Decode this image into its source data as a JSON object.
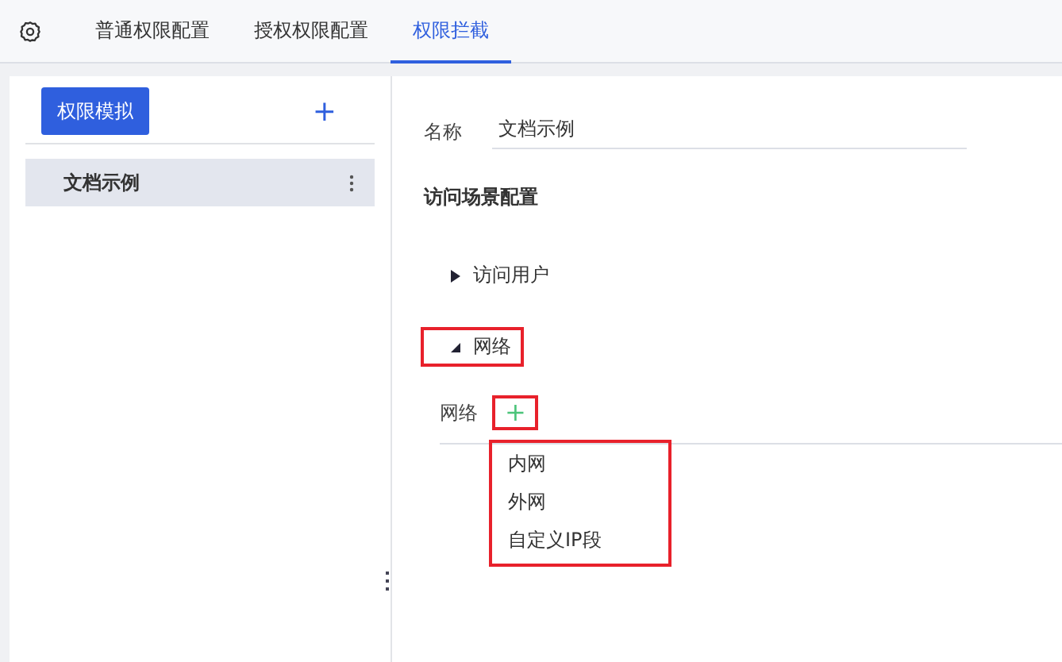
{
  "tabs": [
    {
      "label": "普通权限配置",
      "selected": false
    },
    {
      "label": "授权权限配置",
      "selected": false
    },
    {
      "label": "权限拦截",
      "selected": true
    }
  ],
  "sidebar": {
    "button": "权限模拟",
    "add": "+",
    "items": [
      {
        "label": "文档示例",
        "selected": true
      }
    ]
  },
  "form": {
    "name_label": "名称",
    "name_value": "文档示例",
    "section_title": "访问场景配置",
    "groups": [
      {
        "label": "访问用户",
        "expanded": false,
        "highlighted": false
      },
      {
        "label": "网络",
        "expanded": true,
        "highlighted": true
      }
    ],
    "network": {
      "label": "网络",
      "add": "+",
      "add_highlighted": true,
      "menu_highlighted": true,
      "menu": [
        "内网",
        "外网",
        "自定义IP段"
      ]
    }
  }
}
